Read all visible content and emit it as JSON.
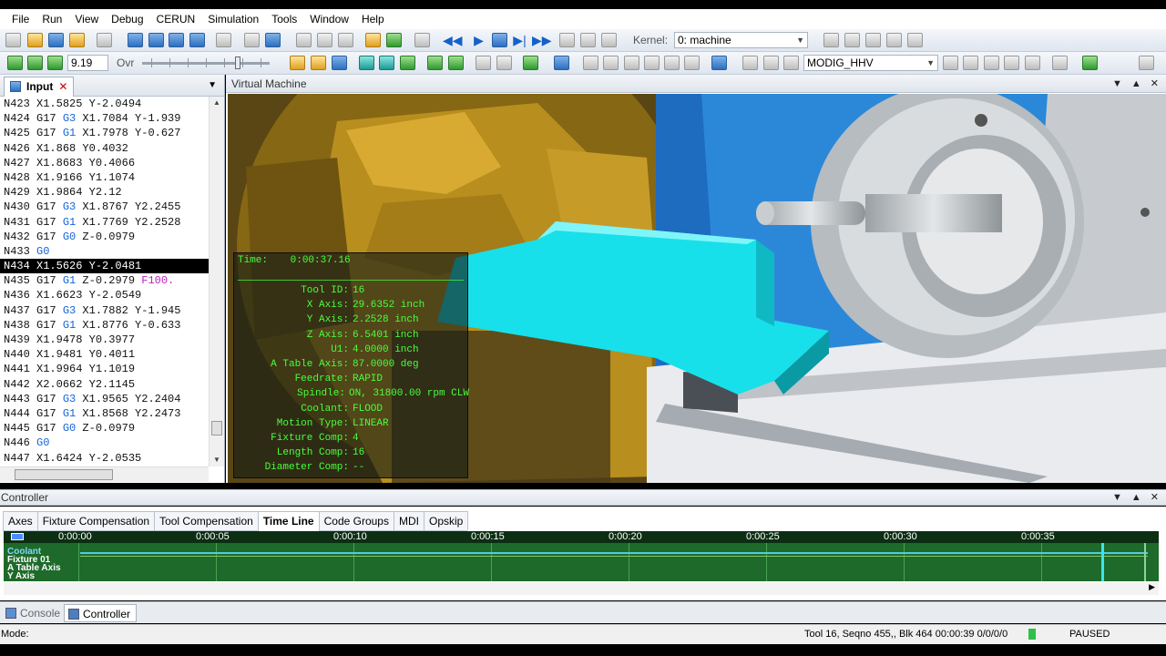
{
  "menu": [
    "File",
    "Run",
    "View",
    "Debug",
    "CERUN",
    "Simulation",
    "Tools",
    "Window",
    "Help"
  ],
  "toolbar": {
    "kernel_label": "Kernel:",
    "kernel_value": "0: machine",
    "speed_value": "9.19",
    "override_label": "Ovr",
    "machine_value": "MODIG_HHV"
  },
  "input_panel": {
    "tab_label": "Input",
    "lines": [
      {
        "n": "N423",
        "parts": [
          {
            "t": " X1.5825 Y-2.0494",
            "c": "w"
          }
        ]
      },
      {
        "n": "N424",
        "parts": [
          {
            "t": " G17 ",
            "c": "w"
          },
          {
            "t": "G3",
            "c": "gc"
          },
          {
            "t": " X1.7084 Y-1.939",
            "c": "w"
          }
        ]
      },
      {
        "n": "N425",
        "parts": [
          {
            "t": " G17 ",
            "c": "w"
          },
          {
            "t": "G1",
            "c": "gc"
          },
          {
            "t": " X1.7978 Y-0.627",
            "c": "w"
          }
        ]
      },
      {
        "n": "N426",
        "parts": [
          {
            "t": " X1.868 Y0.4032",
            "c": "w"
          }
        ]
      },
      {
        "n": "N427",
        "parts": [
          {
            "t": " X1.8683 Y0.4066",
            "c": "w"
          }
        ]
      },
      {
        "n": "N428",
        "parts": [
          {
            "t": " X1.9166 Y1.1074",
            "c": "w"
          }
        ]
      },
      {
        "n": "N429",
        "parts": [
          {
            "t": " X1.9864 Y2.12",
            "c": "w"
          }
        ]
      },
      {
        "n": "N430",
        "parts": [
          {
            "t": " G17 ",
            "c": "w"
          },
          {
            "t": "G3",
            "c": "gc"
          },
          {
            "t": " X1.8767 Y2.2455",
            "c": "w"
          }
        ]
      },
      {
        "n": "N431",
        "parts": [
          {
            "t": " G17 ",
            "c": "w"
          },
          {
            "t": "G1",
            "c": "gc"
          },
          {
            "t": " X1.7769 Y2.2528",
            "c": "w"
          }
        ]
      },
      {
        "n": "N432",
        "parts": [
          {
            "t": " G17 ",
            "c": "w"
          },
          {
            "t": "G0",
            "c": "gc"
          },
          {
            "t": " Z-0.0979",
            "c": "w"
          }
        ]
      },
      {
        "n": "N433",
        "parts": [
          {
            "t": " ",
            "c": "w"
          },
          {
            "t": "G0",
            "c": "gc"
          }
        ]
      },
      {
        "n": "N434",
        "sel": true,
        "parts": [
          {
            "t": " X1.5626 Y-2.0481",
            "c": "w"
          }
        ]
      },
      {
        "n": "N435",
        "parts": [
          {
            "t": " G17 ",
            "c": "w"
          },
          {
            "t": "G1",
            "c": "gc"
          },
          {
            "t": " Z-0.2979 ",
            "c": "w"
          },
          {
            "t": "F100.",
            "c": "fc"
          }
        ]
      },
      {
        "n": "N436",
        "parts": [
          {
            "t": " X1.6623 Y-2.0549",
            "c": "w"
          }
        ]
      },
      {
        "n": "N437",
        "parts": [
          {
            "t": " G17 ",
            "c": "w"
          },
          {
            "t": "G3",
            "c": "gc"
          },
          {
            "t": " X1.7882 Y-1.945",
            "c": "w"
          }
        ]
      },
      {
        "n": "N438",
        "parts": [
          {
            "t": " G17 ",
            "c": "w"
          },
          {
            "t": "G1",
            "c": "gc"
          },
          {
            "t": " X1.8776 Y-0.633",
            "c": "w"
          }
        ]
      },
      {
        "n": "N439",
        "parts": [
          {
            "t": " X1.9478 Y0.3977",
            "c": "w"
          }
        ]
      },
      {
        "n": "N440",
        "parts": [
          {
            "t": " X1.9481 Y0.4011",
            "c": "w"
          }
        ]
      },
      {
        "n": "N441",
        "parts": [
          {
            "t": " X1.9964 Y1.1019",
            "c": "w"
          }
        ]
      },
      {
        "n": "N442",
        "parts": [
          {
            "t": " X2.0662 Y2.1145",
            "c": "w"
          }
        ]
      },
      {
        "n": "N443",
        "parts": [
          {
            "t": " G17 ",
            "c": "w"
          },
          {
            "t": "G3",
            "c": "gc"
          },
          {
            "t": " X1.9565 Y2.2404",
            "c": "w"
          }
        ]
      },
      {
        "n": "N444",
        "parts": [
          {
            "t": " G17 ",
            "c": "w"
          },
          {
            "t": "G1",
            "c": "gc"
          },
          {
            "t": " X1.8568 Y2.2473",
            "c": "w"
          }
        ]
      },
      {
        "n": "N445",
        "parts": [
          {
            "t": " G17 ",
            "c": "w"
          },
          {
            "t": "G0",
            "c": "gc"
          },
          {
            "t": " Z-0.0979",
            "c": "w"
          }
        ]
      },
      {
        "n": "N446",
        "parts": [
          {
            "t": " ",
            "c": "w"
          },
          {
            "t": "G0",
            "c": "gc"
          }
        ]
      },
      {
        "n": "N447",
        "parts": [
          {
            "t": " X1.6424 Y-2.0535",
            "c": "w"
          }
        ]
      }
    ]
  },
  "vm_panel": {
    "title": "Virtual Machine",
    "overlay": {
      "time_label": "Time:",
      "time_value": "0:00:37.16",
      "rows": [
        {
          "k": "Tool ID:",
          "v": "16"
        },
        {
          "k": "X Axis:",
          "v": "29.6352 inch"
        },
        {
          "k": "Y Axis:",
          "v": "2.2528 inch"
        },
        {
          "k": "Z Axis:",
          "v": "6.5401 inch"
        },
        {
          "k": "U1:",
          "v": "4.0000 inch"
        },
        {
          "k": "A Table Axis:",
          "v": "87.0000 deg"
        },
        {
          "k": "Feedrate:",
          "v": "RAPID"
        },
        {
          "k": "Spindle:",
          "v": "ON, 31800.00 rpm CLW"
        },
        {
          "k": "Coolant:",
          "v": "FLOOD"
        },
        {
          "k": "Motion Type:",
          "v": "LINEAR"
        },
        {
          "k": "Fixture Comp:",
          "v": "4"
        },
        {
          "k": "Length Comp:",
          "v": "16"
        },
        {
          "k": "Diameter Comp:",
          "v": "--"
        }
      ]
    }
  },
  "controller": {
    "title": "Controller",
    "tabs": [
      "Axes",
      "Fixture Compensation",
      "Tool Compensation",
      "Time Line",
      "Code Groups",
      "MDI",
      "Opskip"
    ],
    "active_tab": "Time Line",
    "timeline": {
      "ticks": [
        "0:00:00",
        "0:00:05",
        "0:00:10",
        "0:00:15",
        "0:00:20",
        "0:00:25",
        "0:00:30",
        "0:00:35"
      ],
      "labels": [
        "Coolant",
        "Fixture 01",
        "A Table Axis",
        "Y Axis"
      ]
    }
  },
  "bottom_tabs": [
    "Console",
    "Controller"
  ],
  "status": {
    "mode_label": "Mode:",
    "info": "Tool 16,  Seqno 455,, Blk 464  00:00:39  0/0/0/0",
    "state": "PAUSED"
  }
}
